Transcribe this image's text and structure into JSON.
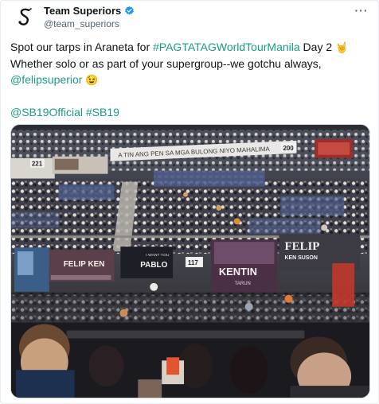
{
  "author": {
    "display_name": "Team Superiors",
    "handle": "@team_superiors",
    "verified": true,
    "avatar_icon": "team-superiors-logo-icon"
  },
  "more_icon": "more-options-icon",
  "tweet": {
    "line1_text": "Spot our tarps in Araneta for ",
    "line1_hashtag": "#PAGTATAGWorldTourManila",
    "line1_suffix": " Day 2 ",
    "line1_emoji": "🤘",
    "line2_text": "Whether solo or as part of your supergroup--we gotchu always,",
    "line3_mention": "@felipsuperior",
    "line3_emoji": "😉",
    "line4_mention": "@SB19Official",
    "line4_hashtag": "#SB19"
  },
  "media": {
    "banner_text": "A TIN ANG PEN SA MGA BULONG NIYO MAHALIMA",
    "section_200": "200",
    "section_221": "221",
    "section_117": "117",
    "tarp_felip_ken_left": "FELIP KEN",
    "tarp_pablo_small": "I WANT YOU",
    "tarp_pablo": "PABLO",
    "tarp_ken_right": "KEN",
    "tarp_felip_right": "FELIP",
    "tarp_ken_suson": "KEN SUSON",
    "tarp_felip_big": "FELIP",
    "tarp_ken_small": "KEN",
    "tarp_justin": "KENTIN",
    "tarp_justin_sub": "TARUN"
  },
  "colors": {
    "accent": "#1a9a88",
    "verified": "#1d9bf0",
    "text": "#0f1419",
    "muted": "#536471"
  }
}
